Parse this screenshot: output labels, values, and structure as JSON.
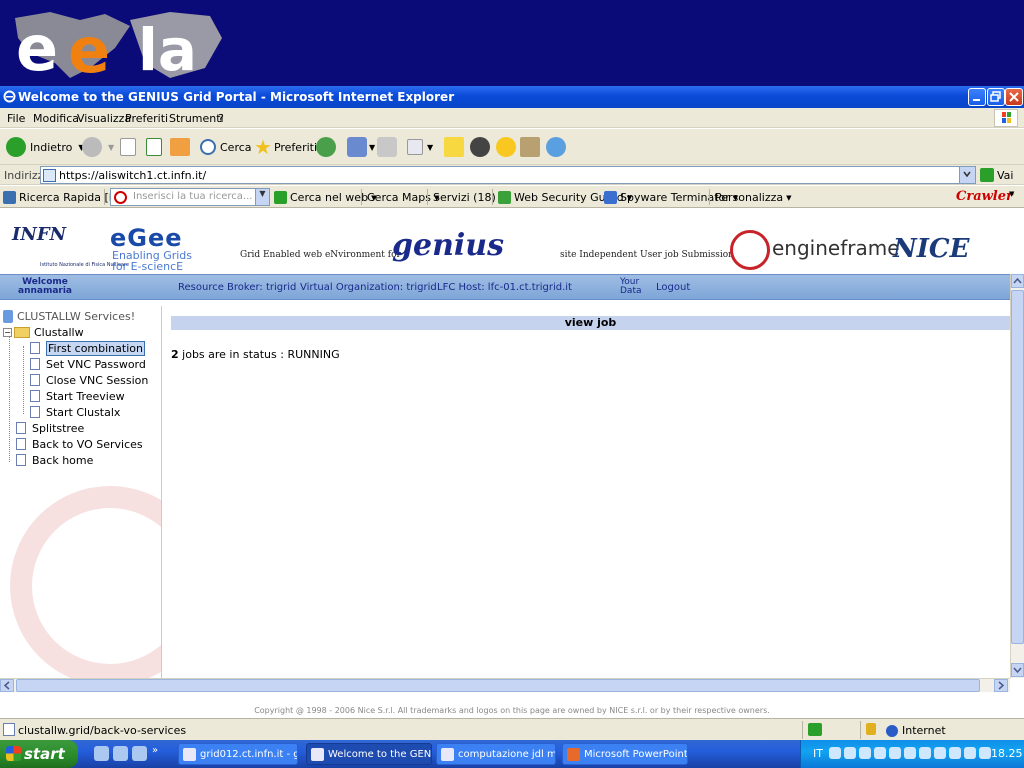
{
  "window": {
    "title": "Welcome to the GENIUS Grid Portal - Microsoft Internet Explorer"
  },
  "banner": {
    "logo": "eela"
  },
  "menu": [
    "File",
    "Modifica",
    "Visualizza",
    "Preferiti",
    "Strumenti",
    "?"
  ],
  "toolbar": {
    "back": "Indietro",
    "search": "Cerca",
    "favorites": "Preferiti"
  },
  "address": {
    "label": "Indirizzo",
    "url": "https://aliswitch1.ct.infn.it/",
    "go": "Vai"
  },
  "linkbar": {
    "quicksearch": "Ricerca Rapida [F3]",
    "search_placeholder": "Inserisci la tua ricerca...",
    "search_web": "Cerca nel web",
    "maps": "Cerca Maps",
    "services": "Servizi (18)",
    "security": "Web Security Guard",
    "spyware": "Spyware Terminator",
    "custom": "Personalizza",
    "crawler": "Crawler"
  },
  "portal": {
    "infn": "INFN",
    "infn_sub": "Istituto Nazionale di Fisica Nucleare",
    "egee": "eGee",
    "egee_sub1": "Enabling Grids",
    "egee_sub2": "for E-sciencE",
    "genius_left": "Grid Enabled web eNvironment for",
    "genius": "genius",
    "genius_right": "site Independent User job Submission",
    "engframe": "engineframe",
    "nice": "NICE"
  },
  "infobar": {
    "welcome1": "Welcome",
    "welcome2": "annamaria",
    "broker": "Resource Broker: trigrid",
    "vo": "Virtual Organization: trigrid",
    "lfc": "LFC Host: lfc-01.ct.trigrid.it",
    "your1": "Your",
    "your2": "Data",
    "logout": "Logout"
  },
  "tree": {
    "root": "CLUSTALLW Services!",
    "folder": "Clustallw",
    "children": [
      "First combination",
      "Set VNC Password",
      "Close VNC Session",
      "Start Treeview",
      "Start Clustalx"
    ],
    "items": [
      "Splitstree",
      "Back to VO Services",
      "Back home"
    ]
  },
  "main": {
    "heading": "view job",
    "count": "2",
    "status_text": " jobs are in status : RUNNING"
  },
  "copyright": "Copyright @ 1998 - 2006 Nice S.r.l. All trademarks and logos on this page are owned by NICE s.r.l. or by their respective owners.",
  "statusbar": {
    "text": "clustallw.grid/back-vo-services",
    "zone": "Internet"
  },
  "taskbar": {
    "start": "start",
    "tasks": [
      "grid012.ct.infn.it - gri...",
      "Welcome to the GENI...",
      "computazione jdl mpi i...",
      "Microsoft PowerPoint ..."
    ],
    "lang": "IT",
    "clock": "18.25"
  }
}
